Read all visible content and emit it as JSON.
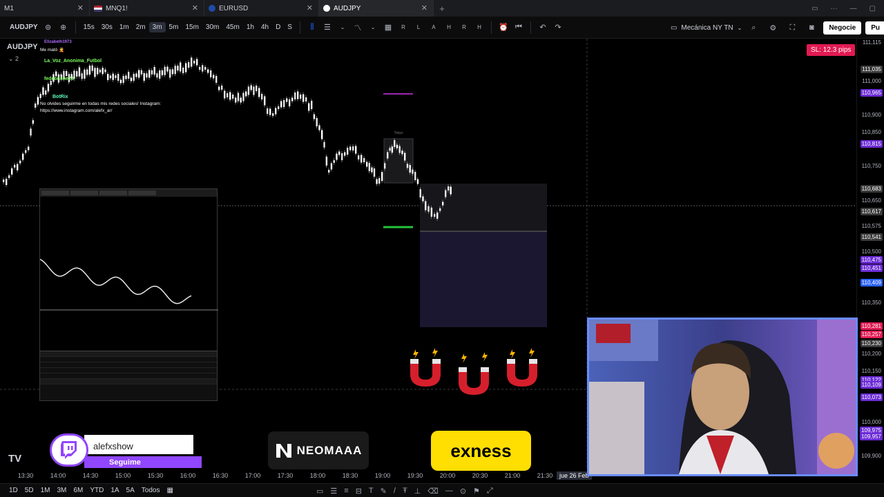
{
  "browser": {
    "tabs": [
      {
        "label": "M1",
        "flag": "",
        "active": false
      },
      {
        "label": "MNQ1!",
        "flag": "us",
        "active": false
      },
      {
        "label": "EURUSD",
        "flag": "eu",
        "active": false
      },
      {
        "label": "AUDJPY",
        "flag": "tv",
        "active": true
      }
    ],
    "new_tab": "+"
  },
  "toolbar": {
    "symbol": "AUDJPY",
    "timeframes": [
      "15s",
      "30s",
      "1m",
      "2m",
      "3m",
      "5m",
      "15m",
      "30m",
      "45m",
      "1h",
      "4h",
      "D",
      "S"
    ],
    "active_timeframe": "3m",
    "replay_letters": [
      "R",
      "L",
      "A",
      "H",
      "R",
      "H"
    ],
    "layout_name": "Mecánica NY TN",
    "trade_label": "Negocie",
    "publish_label": "Pu"
  },
  "chart": {
    "symbol_label": "AUDJPY",
    "collapse_label": "⌄ 2",
    "stop_loss_badge": "SL: 12.3 pips",
    "price_labels": [
      {
        "text": "111,115",
        "tag": false,
        "color": ""
      },
      {
        "text": "111,035",
        "tag": true,
        "color": "#3a3a3a"
      },
      {
        "text": "111,000",
        "tag": false,
        "color": ""
      },
      {
        "text": "110,965",
        "tag": true,
        "color": "#6b2bd6"
      },
      {
        "text": "110,900",
        "tag": false,
        "color": ""
      },
      {
        "text": "110,850",
        "tag": false,
        "color": ""
      },
      {
        "text": "110,815",
        "tag": true,
        "color": "#6b2bd6"
      },
      {
        "text": "110,750",
        "tag": false,
        "color": ""
      },
      {
        "text": "110,683",
        "tag": true,
        "color": "#3a3a3a"
      },
      {
        "text": "110,650",
        "tag": false,
        "color": ""
      },
      {
        "text": "110,617",
        "tag": true,
        "color": "#3a3a3a"
      },
      {
        "text": "110,575",
        "tag": false,
        "color": ""
      },
      {
        "text": "110,541",
        "tag": true,
        "color": "#3a3a3a"
      },
      {
        "text": "110,500",
        "tag": false,
        "color": ""
      },
      {
        "text": "110,475",
        "tag": true,
        "color": "#6b2bd6"
      },
      {
        "text": "110,451",
        "tag": true,
        "color": "#6b2bd6"
      },
      {
        "text": "110,409",
        "tag": true,
        "color": "#2962ff"
      },
      {
        "text": "110,350",
        "tag": false,
        "color": ""
      },
      {
        "text": "110,281",
        "tag": true,
        "color": "#e11a52"
      },
      {
        "text": "110,257",
        "tag": true,
        "color": "#e11a52"
      },
      {
        "text": "110,230",
        "tag": true,
        "color": "#3a3a3a"
      },
      {
        "text": "110,200",
        "tag": false,
        "color": ""
      },
      {
        "text": "110,150",
        "tag": false,
        "color": ""
      },
      {
        "text": "110,122",
        "tag": true,
        "color": "#6b2bd6"
      },
      {
        "text": "110,109",
        "tag": true,
        "color": "#6b2bd6"
      },
      {
        "text": "110,073",
        "tag": true,
        "color": "#6b2bd6"
      },
      {
        "text": "110,000",
        "tag": false,
        "color": ""
      },
      {
        "text": "109,975",
        "tag": true,
        "color": "#6b2bd6"
      },
      {
        "text": "109,957",
        "tag": true,
        "color": "#6b2bd6"
      },
      {
        "text": "109,900",
        "tag": false,
        "color": ""
      }
    ],
    "time_labels": [
      "13:30",
      "14:00",
      "14:30",
      "15:00",
      "15:30",
      "16:00",
      "16:30",
      "17:00",
      "17:30",
      "18:00",
      "18:30",
      "19:00",
      "19:30",
      "20:00",
      "20:30",
      "21:00",
      "21:30"
    ],
    "current_time_label": "jue 26 Feb",
    "small_box_label": "Tokyo"
  },
  "bottom_bar": {
    "ranges": [
      "1D",
      "5D",
      "1M",
      "3M",
      "6M",
      "YTD",
      "1A",
      "5A",
      "Todos"
    ]
  },
  "chat": {
    "messages": [
      {
        "user": "Elizabeth1973",
        "text": "Me mató 🤦",
        "user_color": "#b06cff"
      },
      {
        "user": "La_Voz_Anonima_Futbol",
        "text": "",
        "user_color": "#7cff5e"
      },
      {
        "user": "fedeonline23",
        "text": "",
        "user_color": "#7cff5e"
      },
      {
        "user": "BotRix",
        "text": "No olvides seguirme en todas mis redes sociales! Instagram:",
        "user_color": "#5effb8"
      },
      {
        "user": "",
        "text": "https://www.instagram.com/alefx_ar/",
        "user_color": ""
      }
    ]
  },
  "overlays": {
    "twitch_name": "alefxshow",
    "twitch_follow": "Seguime",
    "sponsor_1": "NEOMAAA",
    "sponsor_2": "exness",
    "tv_logo": "TV"
  }
}
